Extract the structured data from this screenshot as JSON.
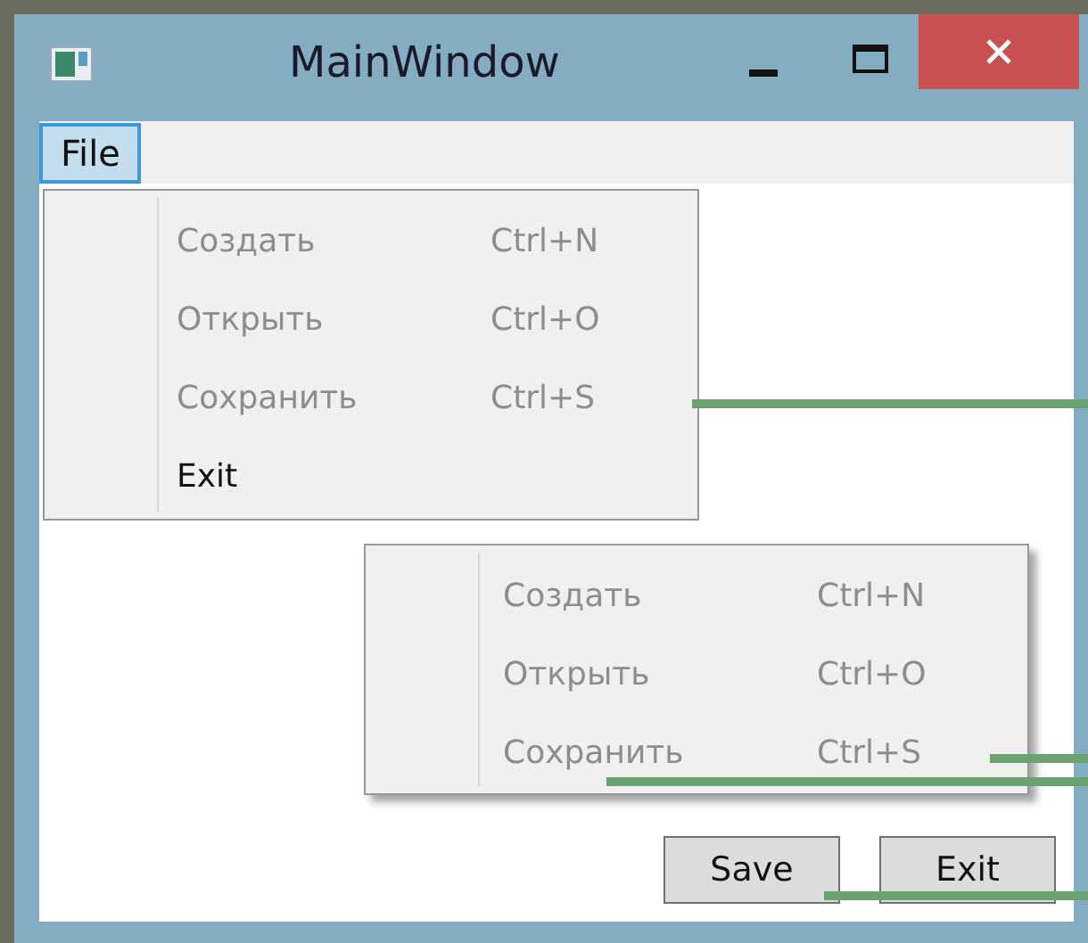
{
  "window": {
    "title": "MainWindow"
  },
  "menu_bar": [
    {
      "label": "File",
      "selected": true
    }
  ],
  "file_menu": {
    "items": [
      {
        "label": "Создать",
        "shortcut": "Ctrl+N",
        "disabled": true
      },
      {
        "label": "Открыть",
        "shortcut": "Ctrl+O",
        "disabled": true
      },
      {
        "label": "Сохранить",
        "shortcut": "Ctrl+S",
        "disabled": true
      },
      {
        "label": "Exit",
        "disabled": false
      }
    ]
  },
  "context_menu": {
    "items": [
      {
        "label": "Создать",
        "shortcut": "Ctrl+N",
        "disabled": true
      },
      {
        "label": "Открыть",
        "shortcut": "Ctrl+O",
        "disabled": true
      },
      {
        "label": "Сохранить",
        "shortcut": "Ctrl+S",
        "disabled": true
      }
    ]
  },
  "buttons": [
    "Save",
    "Exit"
  ]
}
